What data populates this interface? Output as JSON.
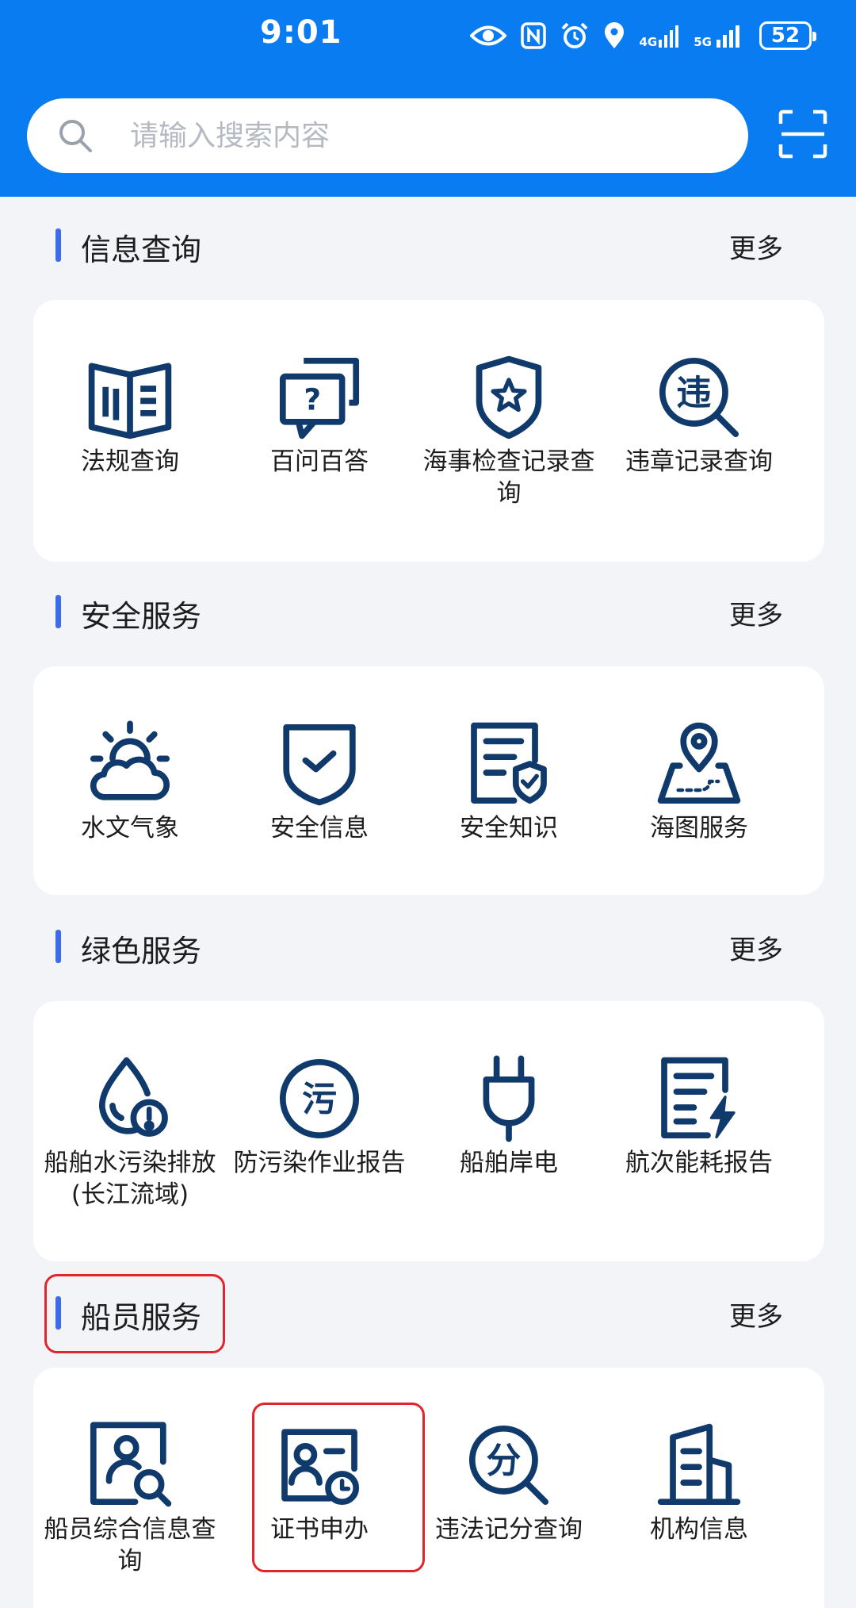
{
  "status_bar": {
    "time": "9:01",
    "battery": "52",
    "net1": "4G",
    "net2": "5G"
  },
  "search": {
    "placeholder": "请输入搜索内容"
  },
  "colors": {
    "primary": "#0a7cf2",
    "icon": "#103a6b",
    "accent_bar": "#3d6ce8",
    "highlight": "#e0262d"
  },
  "sections": [
    {
      "title": "信息查询",
      "more": "更多",
      "items": [
        {
          "label": "法规查询",
          "icon": "book-icon"
        },
        {
          "label": "百问百答",
          "icon": "faq-chat-icon"
        },
        {
          "label": "海事检查记录查询",
          "icon": "shield-star-icon"
        },
        {
          "label": "违章记录查询",
          "icon": "violation-search-icon",
          "glyph": "违"
        }
      ]
    },
    {
      "title": "安全服务",
      "more": "更多",
      "items": [
        {
          "label": "水文气象",
          "icon": "weather-icon"
        },
        {
          "label": "安全信息",
          "icon": "shield-check-icon"
        },
        {
          "label": "安全知识",
          "icon": "document-shield-icon"
        },
        {
          "label": "海图服务",
          "icon": "map-pin-icon"
        }
      ]
    },
    {
      "title": "绿色服务",
      "more": "更多",
      "items": [
        {
          "label": "船舶水污染排放(长江流域)",
          "icon": "water-drop-alert-icon"
        },
        {
          "label": "防污染作业报告",
          "icon": "pollution-icon",
          "glyph": "污"
        },
        {
          "label": "船舶岸电",
          "icon": "plug-icon"
        },
        {
          "label": "航次能耗报告",
          "icon": "energy-report-icon"
        }
      ]
    },
    {
      "title": "船员服务",
      "more": "更多",
      "items": [
        {
          "label": "船员综合信息查询",
          "icon": "crew-search-icon"
        },
        {
          "label": "证书申办",
          "icon": "certificate-icon"
        },
        {
          "label": "违法记分查询",
          "icon": "score-search-icon",
          "glyph": "分"
        },
        {
          "label": "机构信息",
          "icon": "building-icon"
        }
      ]
    }
  ]
}
